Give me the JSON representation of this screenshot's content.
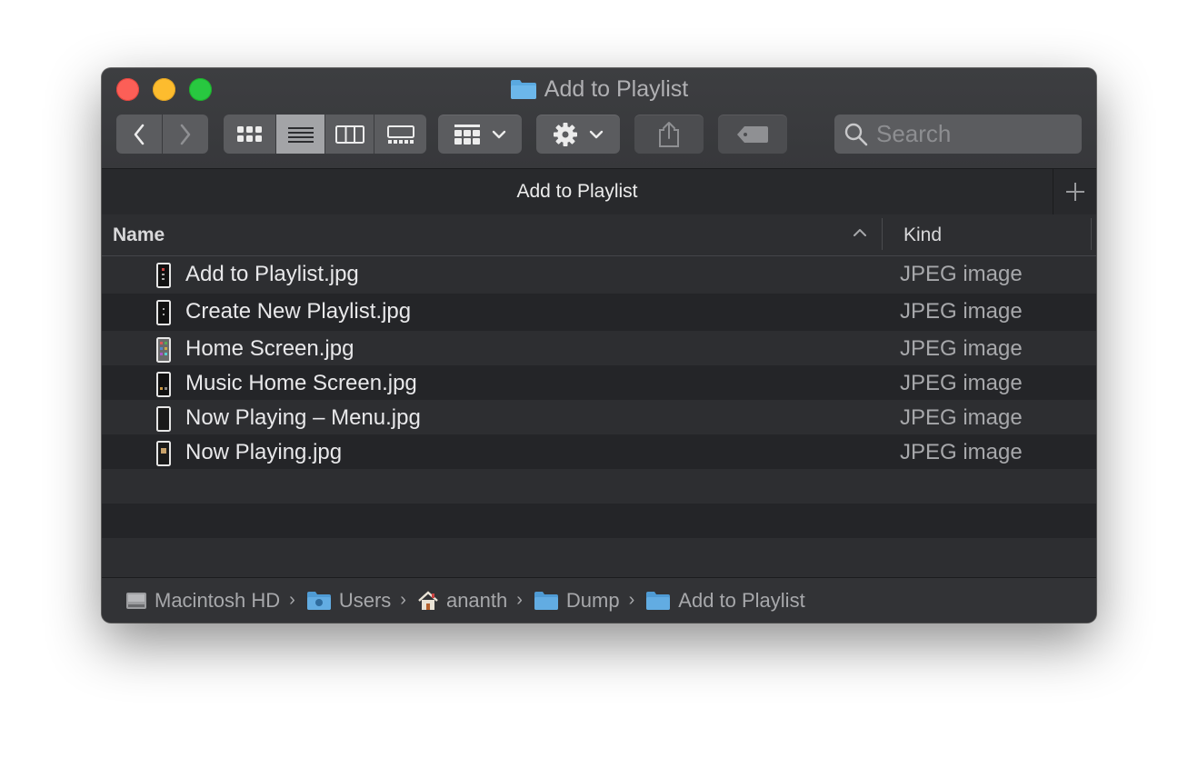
{
  "window": {
    "title": "Add to Playlist"
  },
  "toolbar": {
    "back_icon": "chevron-left-icon",
    "forward_icon": "chevron-right-icon",
    "view_modes": [
      "icon-view",
      "list-view",
      "column-view",
      "gallery-view"
    ],
    "active_view": "list-view",
    "search_placeholder": "Search"
  },
  "tab": {
    "label": "Add to Playlist"
  },
  "columns": {
    "name": "Name",
    "kind": "Kind",
    "sort": "ascending"
  },
  "files": [
    {
      "name": "Add to Playlist.jpg",
      "kind": "JPEG image"
    },
    {
      "name": "Create New Playlist.jpg",
      "kind": "JPEG image"
    },
    {
      "name": "Home Screen.jpg",
      "kind": "JPEG image"
    },
    {
      "name": "Music Home Screen.jpg",
      "kind": "JPEG image"
    },
    {
      "name": "Now Playing – Menu.jpg",
      "kind": "JPEG image"
    },
    {
      "name": "Now Playing.jpg",
      "kind": "JPEG image"
    }
  ],
  "path": [
    {
      "label": "Macintosh HD",
      "icon": "hard-drive-icon"
    },
    {
      "label": "Users",
      "icon": "users-folder-icon"
    },
    {
      "label": "ananth",
      "icon": "home-icon"
    },
    {
      "label": "Dump",
      "icon": "folder-icon"
    },
    {
      "label": "Add to Playlist",
      "icon": "folder-icon"
    }
  ],
  "colors": {
    "window_bg": "#2d2e31",
    "folder_blue": "#5aa9e0",
    "close": "#fc5f57",
    "minimize": "#fdbc2e",
    "zoom": "#28c840"
  }
}
